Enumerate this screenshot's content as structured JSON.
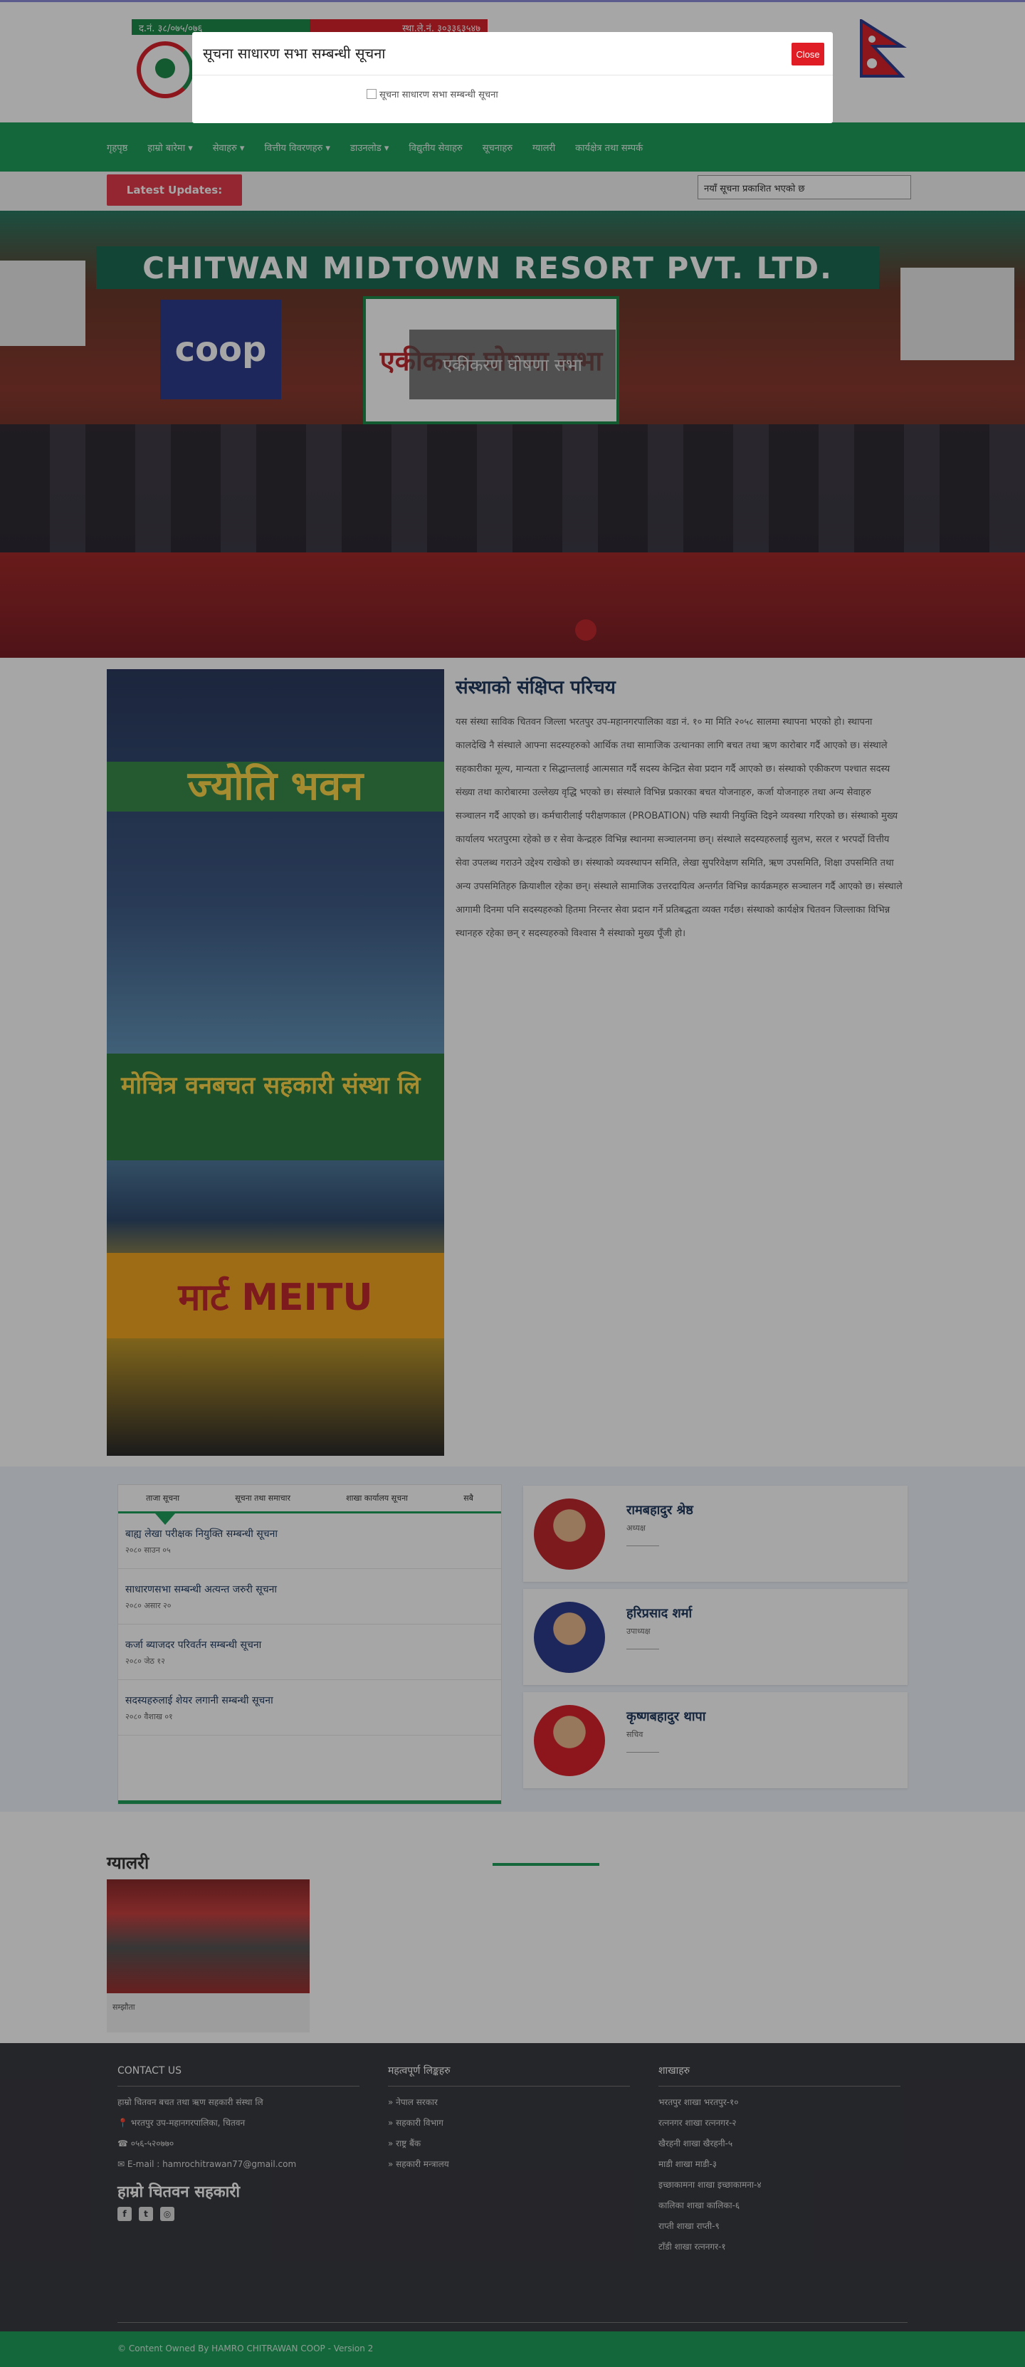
{
  "header": {
    "reg_left": "द.नं. ३८/०७५/०७६",
    "reg_right": "स्था.ले.नं. ३०३३६३५४७"
  },
  "nav": {
    "items": [
      "गृहपृष्ठ",
      "हाम्रो बारेमा ▾",
      "सेवाहरु ▾",
      "वित्तीय विवरणहरु ▾",
      "डाउनलोड ▾",
      "विद्युतीय सेवाहरु",
      "सूचनाहरु",
      "ग्यालरी",
      "कार्यक्षेत्र तथा सम्पर्क"
    ]
  },
  "updates": {
    "label": "Latest Updates:",
    "ticker": "नयाँ सूचना प्रकाशित भएको छ"
  },
  "hero": {
    "banner": "CHITWAN MIDTOWN RESORT PVT. LTD.",
    "coop": "coop",
    "poster": "एकीकरण घोषणा सभा",
    "caption": "एकीकरण घोषणा सभा"
  },
  "about": {
    "title": "संस्थाको संक्षिप्त परिचय",
    "sign1": "ज्योति भवन",
    "sign2": "मोचित्र वनबचत सहकारी संस्था लि",
    "sign3": "मार्ट MEITU",
    "text": "यस संस्था साविक चितवन जिल्ला भरतपुर उप-महानगरपालिका वडा नं. १० मा मिति २०५८ सालमा स्थापना भएको हो। स्थापना कालदेखि नै संस्थाले आफ्ना सदस्यहरुको आर्थिक तथा सामाजिक उत्थानका लागि बचत तथा ऋण कारोबार गर्दै आएको छ। संस्थाले सहकारीका मूल्य, मान्यता र सिद्धान्तलाई आत्मसात गर्दै सदस्य केन्द्रित सेवा प्रदान गर्दै आएको छ। संस्थाको एकीकरण पश्चात सदस्य संख्या तथा कारोबारमा उल्लेख्य वृद्धि भएको छ। संस्थाले विभिन्न प्रकारका बचत योजनाहरु, कर्जा योजनाहरु तथा अन्य सेवाहरु सञ्चालन गर्दै आएको छ। कर्मचारीलाई परीक्षणकाल (PROBATION) पछि स्थायी नियुक्ति दिइने व्यवस्था गरिएको छ। संस्थाको मुख्य कार्यालय भरतपुरमा रहेको छ र सेवा केन्द्रहरु विभिन्न स्थानमा सञ्चालनमा छन्। संस्थाले सदस्यहरुलाई सुलभ, सरल र भरपर्दो वित्तीय सेवा उपलब्ध गराउने उद्देश्य राखेको छ। संस्थाको व्यवस्थापन समिति, लेखा सुपरिवेक्षण समिति, ऋण उपसमिति, शिक्षा उपसमिति तथा अन्य उपसमितिहरु क्रियाशील रहेका छन्। संस्थाले सामाजिक उत्तरदायित्व अन्तर्गत विभिन्न कार्यक्रमहरु सञ्चालन गर्दै आएको छ। संस्थाले आगामी दिनमा पनि सदस्यहरुको हितमा निरन्तर सेवा प्रदान गर्ने प्रतिबद्धता व्यक्त गर्दछ। संस्थाको कार्यक्षेत्र चितवन जिल्लाका विभिन्न स्थानहरु रहेका छन् र सदस्यहरुको विश्वास नै संस्थाको मुख्य पूँजी हो।"
  },
  "notices": {
    "tabs": [
      "ताजा सूचना",
      "सूचना तथा समाचार",
      "शाखा कार्यालय सूचना",
      "सबै"
    ],
    "items": [
      {
        "title": "बाह्य लेखा परीक्षक नियुक्ति सम्बन्धी सूचना",
        "date": "२०८० साउन ०५"
      },
      {
        "title": "साधारणसभा सम्बन्धी अत्यन्त जरुरी सूचना",
        "date": "२०८० असार २०"
      },
      {
        "title": "कर्जा ब्याजदर परिवर्तन सम्बन्धी सूचना",
        "date": "२०८० जेठ १२"
      },
      {
        "title": "सदस्यहरुलाई शेयर लगानी सम्बन्धी सूचना",
        "date": "२०८० वैशाख ०१"
      }
    ]
  },
  "people": [
    {
      "name": "रामबहादुर श्रेष्ठ",
      "role": "अध्यक्ष",
      "color": "#c0282f"
    },
    {
      "name": "हरिप्रसाद शर्मा",
      "role": "उपाध्यक्ष",
      "color": "#2f3d8c"
    },
    {
      "name": "कृष्णबहादुर थापा",
      "role": "सचिव",
      "color": "#d9232d"
    }
  ],
  "gallery": {
    "title": "ग्यालरी",
    "caption": "सम्झौता"
  },
  "footer": {
    "contact_heading": "CONTACT US",
    "contact_lines": [
      "हाम्रो चितवन बचत तथा ऋण सहकारी संस्था लि",
      "📍 भरतपुर उप-महानगरपालिका, चितवन",
      "☎ ०५६-५२०७७०",
      "✉ E-mail : hamrochitrawan77@gmail.com"
    ],
    "big_title": "हाम्रो चितवन सहकारी",
    "social": [
      "f",
      "t",
      "◎"
    ],
    "links_heading": "महत्वपूर्ण लिङ्कहरु",
    "links": [
      "» नेपाल सरकार",
      "» सहकारी विभाग",
      "» राष्ट्र बैंक",
      "» सहकारी मन्त्रालय"
    ],
    "branches_heading": "शाखाहरु",
    "branches": [
      "भरतपुर शाखा भरतपुर-१०",
      "रत्ननगर शाखा रत्ननगर-२",
      "खैरहनी शाखा खैरहनी-५",
      "माडी शाखा माडी-३",
      "इच्छाकामना शाखा इच्छाकामना-४",
      "कालिका शाखा कालिका-६",
      "राप्ती शाखा राप्ती-९",
      "टाँडी शाखा रत्ननगर-१"
    ],
    "copyright": "© Content Owned By HAMRO CHITRAWAN COOP - Version 2"
  },
  "modal": {
    "title": "सूचना साधारण सभा सम्बन्धी सूचना",
    "close_label": "Close",
    "image_alt": "सूचना साधारण सभा सम्बन्धी सूचना"
  },
  "colors": {
    "brand_green": "#1e9e5a",
    "brand_red": "#e23b4a",
    "footer_bg": "#3a3b40"
  }
}
